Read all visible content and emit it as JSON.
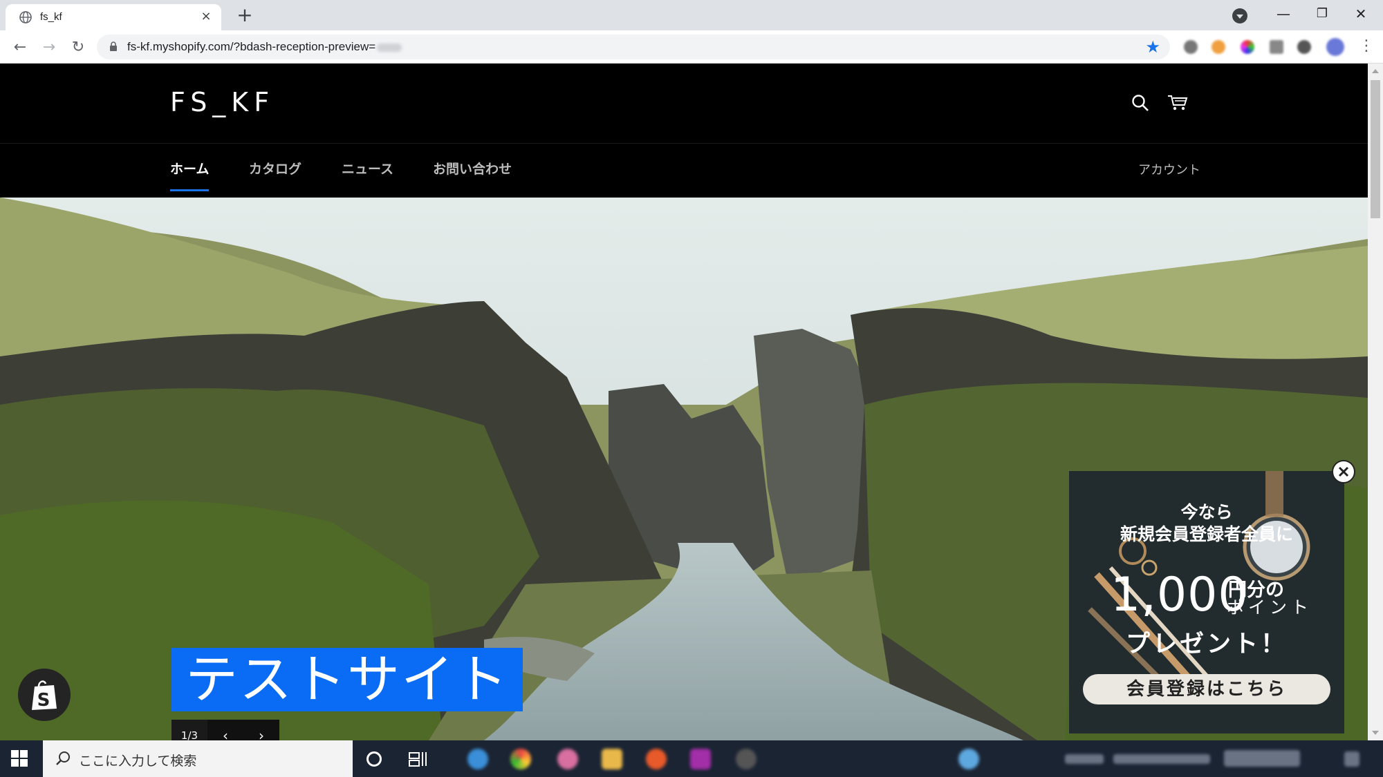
{
  "browser": {
    "tab_title": "fs_kf",
    "tab_close": "×",
    "new_tab": "+",
    "url": "fs-kf.myshopify.com/?bdash-reception-preview=",
    "window_controls": {
      "minimize": "—",
      "maximize": "❐",
      "close": "✕"
    },
    "nav": {
      "back": "←",
      "forward": "→",
      "reload": "↻"
    },
    "bookmark_star": "★",
    "menu": "⋮"
  },
  "site": {
    "logo": "FS_KF",
    "nav": [
      {
        "label": "ホーム",
        "active": true
      },
      {
        "label": "カタログ",
        "active": false
      },
      {
        "label": "ニュース",
        "active": false
      },
      {
        "label": "お問い合わせ",
        "active": false
      }
    ],
    "account": "アカウント",
    "header_icons": [
      "search-icon",
      "cart-icon"
    ]
  },
  "hero": {
    "title": "テストサイト",
    "counter": "1/3",
    "prev": "‹",
    "next": "›"
  },
  "promo": {
    "line1": "今なら",
    "line2": "新規会員登録者全員に",
    "amount": "1,000",
    "amount_suffix1": "円分の",
    "amount_suffix2": "ポイント",
    "present": "プレゼント！",
    "cta": "会員登録はこちら"
  },
  "taskbar": {
    "search_placeholder": "ここに入力して検索"
  },
  "colors": {
    "accent": "#0a6cf5",
    "header_bg": "#000000",
    "taskbar_bg": "#1b2433"
  }
}
